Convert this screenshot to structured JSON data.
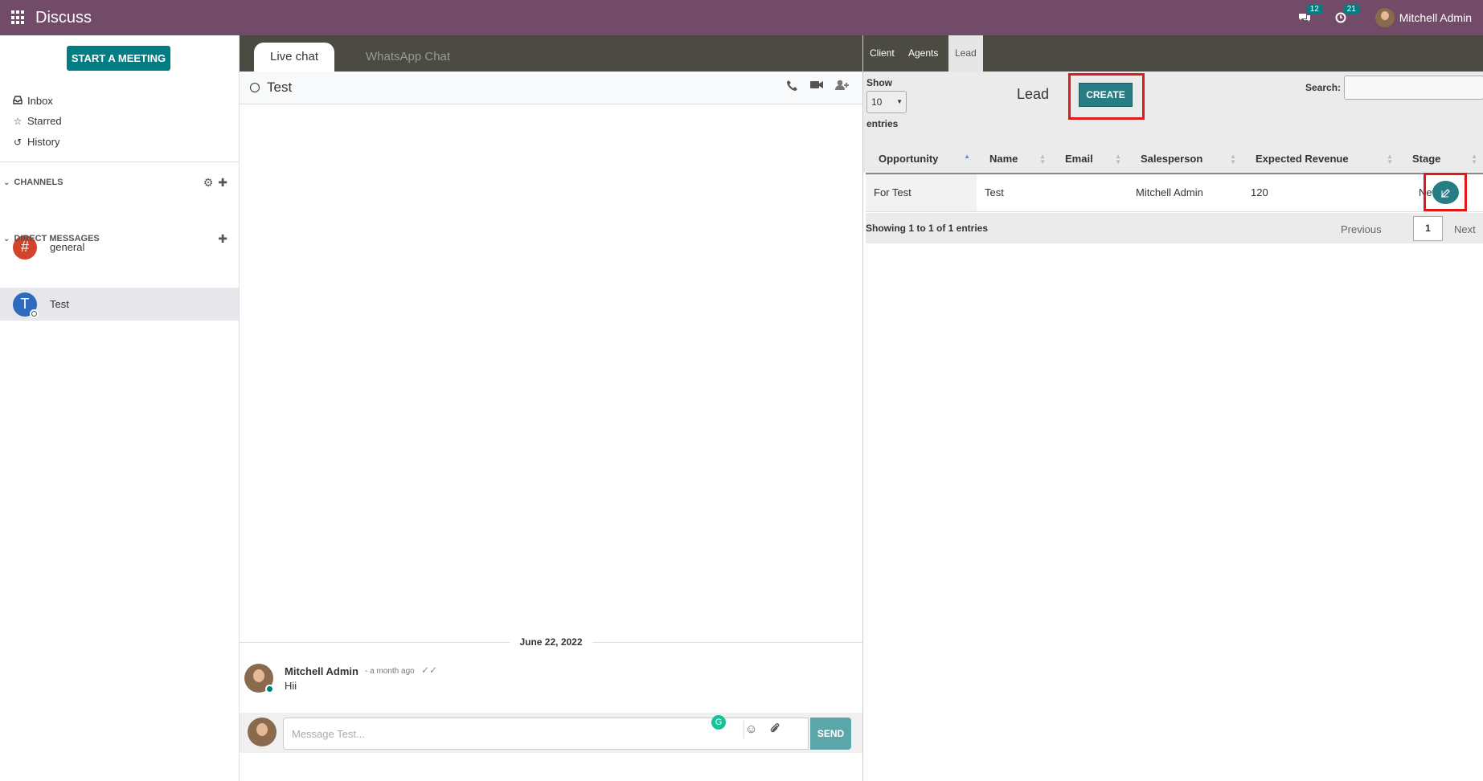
{
  "app": {
    "title": "Discuss"
  },
  "navbar": {
    "messages_count": "12",
    "activities_count": "21",
    "user_name": "Mitchell Admin"
  },
  "sidebar": {
    "start_meeting_label": "START A MEETING",
    "mailboxes": [
      {
        "label": "Inbox",
        "icon": "inbox-icon"
      },
      {
        "label": "Starred",
        "icon": "star-icon"
      },
      {
        "label": "History",
        "icon": "history-icon"
      }
    ],
    "channels_header": "CHANNELS",
    "channels": [
      {
        "label": "general",
        "icon": "hashtag-icon",
        "color": "#d2442b"
      }
    ],
    "dm_header": "DIRECT MESSAGES",
    "direct_messages": [
      {
        "label": "Test",
        "initial": "T",
        "color": "#2f6bbd"
      }
    ]
  },
  "chat": {
    "tabs": [
      "Live chat",
      "WhatsApp Chat"
    ],
    "thread_name": "Test",
    "date_separator": "June 22, 2022",
    "message": {
      "author": "Mitchell Admin",
      "date": "- a month ago",
      "body": "Hii"
    },
    "composer": {
      "placeholder": "Message Test...",
      "send_label": "SEND"
    }
  },
  "panel": {
    "tabs": [
      "Client",
      "Agents",
      "Lead"
    ],
    "active_tab": "Lead",
    "show_label": "Show",
    "page_size": "10",
    "entries_label": "entries",
    "title": "Lead",
    "create_label": "CREATE",
    "search_label": "Search:",
    "columns": [
      "Opportunity",
      "Name",
      "Email",
      "Salesperson",
      "Expected Revenue",
      "Stage"
    ],
    "rows": [
      {
        "opportunity": "For Test",
        "name": "Test",
        "email": "",
        "salesperson": "Mitchell Admin",
        "revenue": "120",
        "stage": "New"
      }
    ],
    "info": "Showing 1 to 1 of 1 entries",
    "previous_label": "Previous",
    "current_page": "1",
    "next_label": "Next"
  },
  "colors": {
    "navbar": "#714b67",
    "primary": "#017e84",
    "highlight_frame": "#e01a1a"
  }
}
